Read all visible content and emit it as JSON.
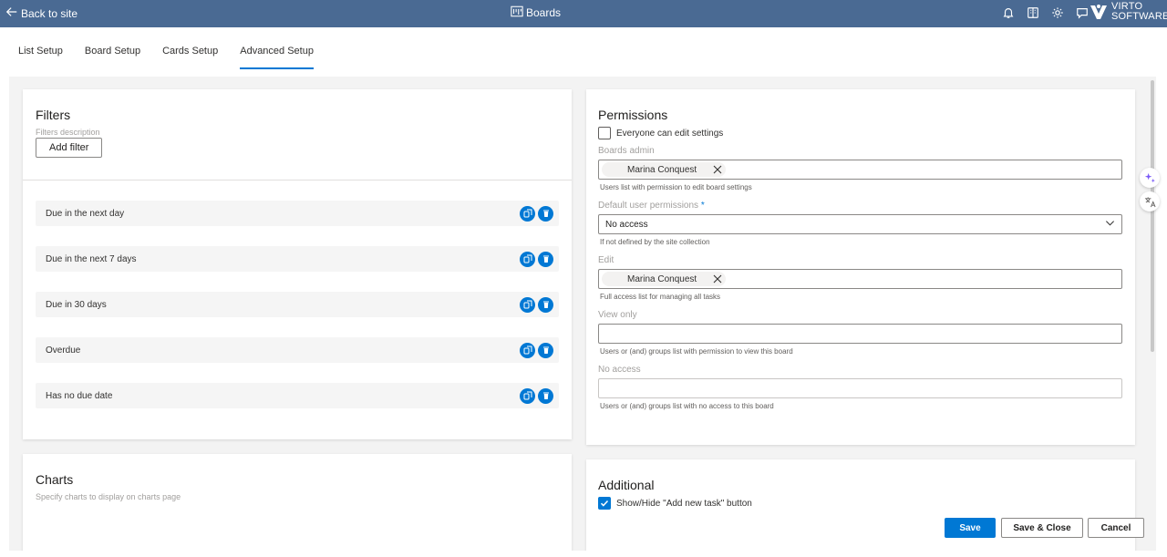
{
  "topbar": {
    "back_label": "Back to site",
    "title": "Boards",
    "icons": [
      "bell-icon",
      "book-icon",
      "gear-icon",
      "chat-icon"
    ],
    "logo_line1": "VIRTO",
    "logo_line2": "SOFTWARE"
  },
  "tabs": [
    {
      "label": "List Setup",
      "active": false
    },
    {
      "label": "Board Setup",
      "active": false
    },
    {
      "label": "Cards Setup",
      "active": false
    },
    {
      "label": "Advanced Setup",
      "active": true
    }
  ],
  "filters": {
    "title": "Filters",
    "description": "Filters description",
    "add_button": "Add filter",
    "items": [
      {
        "label": "Due in the next day"
      },
      {
        "label": "Due in the next 7 days"
      },
      {
        "label": "Due in 30 days"
      },
      {
        "label": "Overdue"
      },
      {
        "label": "Has no due date"
      }
    ]
  },
  "charts": {
    "title": "Charts",
    "description": "Specify charts to display on charts page"
  },
  "permissions": {
    "title": "Permissions",
    "everyone_can_edit": {
      "label": "Everyone can edit settings",
      "checked": false
    },
    "boards_admin": {
      "label": "Boards admin",
      "user": "Marina Conquest",
      "hint": "Users list with permission to edit board settings"
    },
    "default_permissions": {
      "label": "Default user permissions",
      "required_mark": "*",
      "value": "No access",
      "hint": "If not defined by the site collection"
    },
    "edit": {
      "label": "Edit",
      "user": "Marina Conquest",
      "hint": "Full access list for managing all tasks"
    },
    "view_only": {
      "label": "View only",
      "hint": "Users or (and) groups list with permission to view this board"
    },
    "no_access": {
      "label": "No access",
      "hint": "Users or (and) groups list with no access to this board"
    }
  },
  "additional": {
    "title": "Additional",
    "show_hide": {
      "label": "Show/Hide \"Add new task\" button",
      "checked": true
    }
  },
  "footer": {
    "save": "Save",
    "save_close": "Save & Close",
    "cancel": "Cancel"
  },
  "colors": {
    "topbar": "#4a6a93",
    "accent": "#0078d4"
  }
}
